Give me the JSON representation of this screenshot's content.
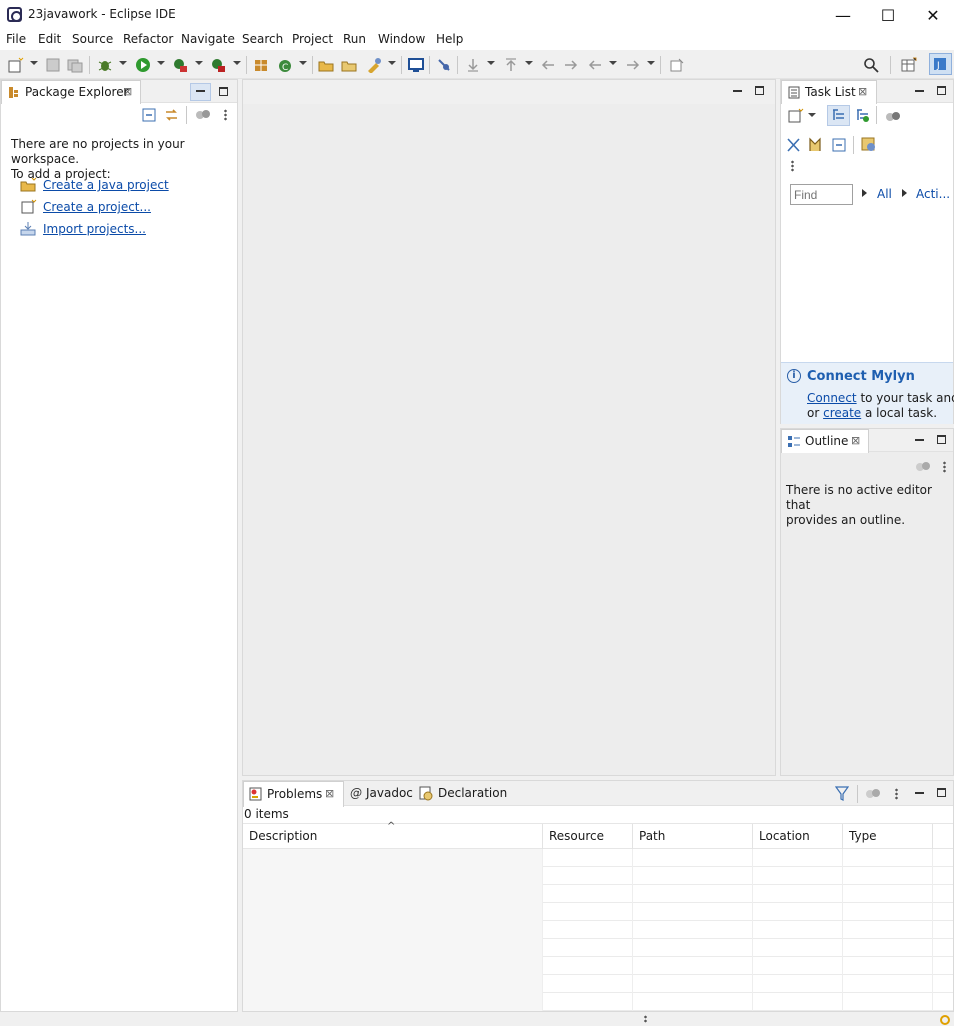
{
  "window": {
    "title": "23javawork - Eclipse IDE",
    "minimize_glyph": "—",
    "maximize_glyph": "☐",
    "close_glyph": "✕"
  },
  "menu": [
    "File",
    "Edit",
    "Source",
    "Refactor",
    "Navigate",
    "Search",
    "Project",
    "Run",
    "Window",
    "Help"
  ],
  "package_explorer": {
    "tab_label": "Package Explorer",
    "empty_line1": "There are no projects in your workspace.",
    "empty_line2": "To add a project:",
    "links": [
      "Create a Java project",
      "Create a project...",
      "Import projects..."
    ]
  },
  "task_list": {
    "tab_label": "Task List",
    "find_placeholder": "Find",
    "filter_all": "All",
    "filter_activate": "Acti..."
  },
  "mylyn": {
    "title": "Connect Mylyn",
    "connect_link": "Connect",
    "connect_rest": " to your task and A",
    "or_text": "or ",
    "create_link": "create",
    "create_rest": " a local task."
  },
  "outline": {
    "tab_label": "Outline",
    "empty_line1": "There is no active editor that",
    "empty_line2": "provides an outline."
  },
  "bottom": {
    "tabs": [
      "Problems",
      "Javadoc",
      "Declaration"
    ],
    "javadoc_glyph": "@",
    "sort_glyph": "^",
    "items_count": "0 items",
    "columns": [
      "Description",
      "Resource",
      "Path",
      "Location",
      "Type"
    ]
  },
  "colors": {
    "link": "#0b4ba8",
    "accent": "#3b7ac9",
    "info_bg": "#e8f0f9"
  }
}
